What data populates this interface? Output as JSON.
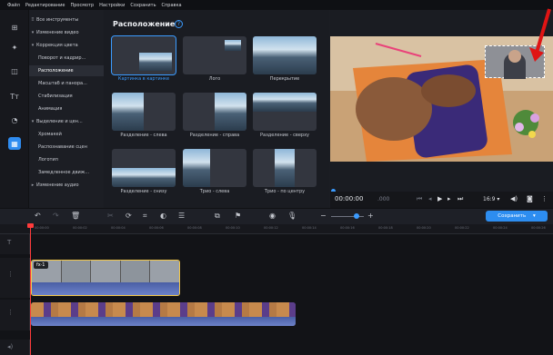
{
  "menu": [
    "Файл",
    "Редактирование",
    "Просмотр",
    "Настройки",
    "Сохранить",
    "Справка"
  ],
  "categories": [
    {
      "label": "Все инструменты",
      "arrow": "⠿",
      "selected": false
    },
    {
      "label": "Изменение видео",
      "arrow": "▾",
      "selected": false
    },
    {
      "label": "Коррекция цвета",
      "arrow": "▾",
      "selected": false
    },
    {
      "label": "Поворот и кадрир...",
      "arrow": "",
      "selected": false
    },
    {
      "label": "Расположение",
      "arrow": "",
      "selected": true
    },
    {
      "label": "Масштаб и панора...",
      "arrow": "",
      "selected": false
    },
    {
      "label": "Стабилизация",
      "arrow": "",
      "selected": false
    },
    {
      "label": "Анимация",
      "arrow": "",
      "selected": false
    },
    {
      "label": "Выделение и цен...",
      "arrow": "▾",
      "selected": false
    },
    {
      "label": "Хромакей",
      "arrow": "",
      "selected": false
    },
    {
      "label": "Распознавание сцен",
      "arrow": "",
      "selected": false
    },
    {
      "label": "Логотип",
      "arrow": "",
      "selected": false
    },
    {
      "label": "Замедленное движ...",
      "arrow": "",
      "selected": false
    },
    {
      "label": "Изменение аудио",
      "arrow": "▸",
      "selected": false
    }
  ],
  "panel": {
    "title": "Расположение",
    "help": "?"
  },
  "tiles": [
    {
      "label": "Картинка в картинке",
      "selected": true
    },
    {
      "label": "Лого",
      "selected": false
    },
    {
      "label": "Перекрытие",
      "selected": false
    },
    {
      "label": "Разделение - слева",
      "selected": false
    },
    {
      "label": "Разделение - справа",
      "selected": false
    },
    {
      "label": "Разделение - сверху",
      "selected": false
    },
    {
      "label": "Разделение - снизу",
      "selected": false
    },
    {
      "label": "Трио - слева",
      "selected": false
    },
    {
      "label": "Трио - по центру",
      "selected": false
    }
  ],
  "player": {
    "timecode": "00:00:00",
    "timecode_frac": ".000",
    "aspect": "16:9 ▾"
  },
  "toolbar": {
    "save_label": "Сохранить"
  },
  "ruler": [
    "00:00:00",
    "00:00:02",
    "00:00:04",
    "00:00:06",
    "00:00:08",
    "00:00:10",
    "00:00:12",
    "00:00:14",
    "00:00:16",
    "00:00:18",
    "00:00:20",
    "00:00:22",
    "00:00:24",
    "00:00:26",
    "00:00:28"
  ],
  "clip": {
    "fx": "fx·1"
  },
  "colors": {
    "accent": "#2d8df0",
    "selected_clip": "#f3c84b",
    "playhead": "#ff3b3b",
    "arrow": "#e01414"
  }
}
